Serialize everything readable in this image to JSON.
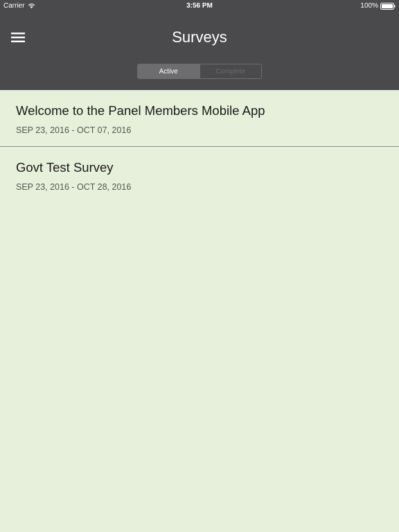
{
  "status_bar": {
    "carrier": "Carrier",
    "time": "3:56 PM",
    "battery": "100%"
  },
  "header": {
    "title": "Surveys",
    "menu_icon": "hamburger-icon",
    "background": "#4a4a4c"
  },
  "segmented_control": {
    "options": [
      "Active",
      "Complete"
    ],
    "selected": "Active"
  },
  "surveys": [
    {
      "title": "Welcome to the Panel Members Mobile App",
      "dates": "SEP 23, 2016 - OCT 07, 2016"
    },
    {
      "title": "Govt Test Survey",
      "dates": "SEP 23, 2016 - OCT 28, 2016"
    }
  ],
  "colors": {
    "list_background": "#e7f0da",
    "header_background": "#4a4a4c"
  }
}
